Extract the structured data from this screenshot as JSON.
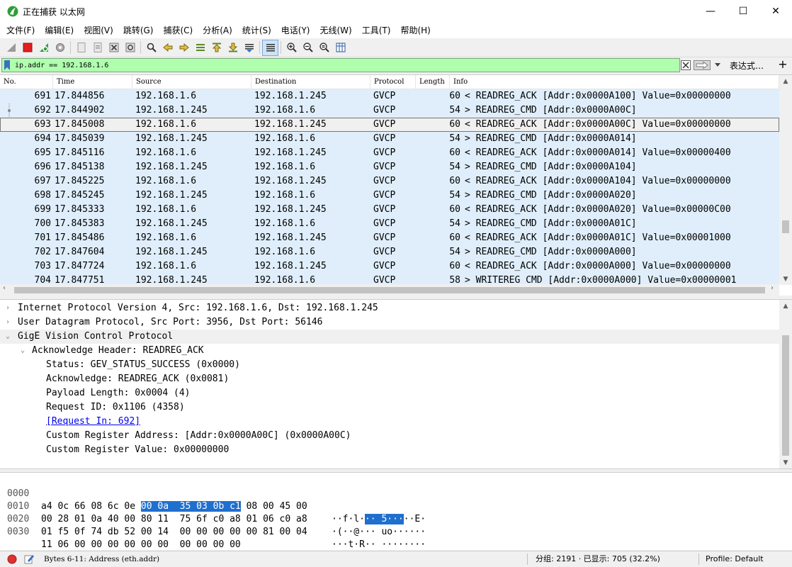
{
  "window": {
    "title": "正在捕获 以太网",
    "minimize": "—",
    "maximize": "☐",
    "close": "✕"
  },
  "menu": [
    "文件(F)",
    "编辑(E)",
    "视图(V)",
    "跳转(G)",
    "捕获(C)",
    "分析(A)",
    "统计(S)",
    "电话(Y)",
    "无线(W)",
    "工具(T)",
    "帮助(H)"
  ],
  "filter": {
    "value": "ip.addr == 192.168.1.6",
    "expression_label": "表达式…",
    "plus_label": "+"
  },
  "packet_list": {
    "columns": [
      "No.",
      "Time",
      "Source",
      "Destination",
      "Protocol",
      "Length",
      "Info"
    ],
    "rows": [
      {
        "no": "691",
        "time": "17.844856",
        "src": "192.168.1.6",
        "dst": "192.168.1.245",
        "proto": "GVCP",
        "len": "60",
        "info": "< READREG_ACK [Addr:0x0000A100] Value=0x00000000"
      },
      {
        "no": "692",
        "time": "17.844902",
        "src": "192.168.1.245",
        "dst": "192.168.1.6",
        "proto": "GVCP",
        "len": "54",
        "info": "> READREG_CMD [Addr:0x0000A00C]"
      },
      {
        "no": "693",
        "time": "17.845008",
        "src": "192.168.1.6",
        "dst": "192.168.1.245",
        "proto": "GVCP",
        "len": "60",
        "info": "< READREG_ACK [Addr:0x0000A00C] Value=0x00000000"
      },
      {
        "no": "694",
        "time": "17.845039",
        "src": "192.168.1.245",
        "dst": "192.168.1.6",
        "proto": "GVCP",
        "len": "54",
        "info": "> READREG_CMD [Addr:0x0000A014]"
      },
      {
        "no": "695",
        "time": "17.845116",
        "src": "192.168.1.6",
        "dst": "192.168.1.245",
        "proto": "GVCP",
        "len": "60",
        "info": "< READREG_ACK [Addr:0x0000A014] Value=0x00000400"
      },
      {
        "no": "696",
        "time": "17.845138",
        "src": "192.168.1.245",
        "dst": "192.168.1.6",
        "proto": "GVCP",
        "len": "54",
        "info": "> READREG_CMD [Addr:0x0000A104]"
      },
      {
        "no": "697",
        "time": "17.845225",
        "src": "192.168.1.6",
        "dst": "192.168.1.245",
        "proto": "GVCP",
        "len": "60",
        "info": "< READREG_ACK [Addr:0x0000A104] Value=0x00000000"
      },
      {
        "no": "698",
        "time": "17.845245",
        "src": "192.168.1.245",
        "dst": "192.168.1.6",
        "proto": "GVCP",
        "len": "54",
        "info": "> READREG_CMD [Addr:0x0000A020]"
      },
      {
        "no": "699",
        "time": "17.845333",
        "src": "192.168.1.6",
        "dst": "192.168.1.245",
        "proto": "GVCP",
        "len": "60",
        "info": "< READREG_ACK [Addr:0x0000A020] Value=0x00000C00"
      },
      {
        "no": "700",
        "time": "17.845383",
        "src": "192.168.1.245",
        "dst": "192.168.1.6",
        "proto": "GVCP",
        "len": "54",
        "info": "> READREG_CMD [Addr:0x0000A01C]"
      },
      {
        "no": "701",
        "time": "17.845486",
        "src": "192.168.1.6",
        "dst": "192.168.1.245",
        "proto": "GVCP",
        "len": "60",
        "info": "< READREG_ACK [Addr:0x0000A01C] Value=0x00001000"
      },
      {
        "no": "702",
        "time": "17.847604",
        "src": "192.168.1.245",
        "dst": "192.168.1.6",
        "proto": "GVCP",
        "len": "54",
        "info": "> READREG_CMD [Addr:0x0000A000]"
      },
      {
        "no": "703",
        "time": "17.847724",
        "src": "192.168.1.6",
        "dst": "192.168.1.245",
        "proto": "GVCP",
        "len": "60",
        "info": "< READREG_ACK [Addr:0x0000A000] Value=0x00000000"
      },
      {
        "no": "704",
        "time": "17.847751",
        "src": "192.168.1.245",
        "dst": "192.168.1.6",
        "proto": "GVCP",
        "len": "58",
        "info": "> WRITEREG_CMD [Addr:0x0000A000] Value=0x00000001"
      }
    ]
  },
  "details": {
    "lines": [
      "Internet Protocol Version 4, Src: 192.168.1.6, Dst: 192.168.1.245",
      "User Datagram Protocol, Src Port: 3956, Dst Port: 56146",
      "GigE Vision Control Protocol",
      "Acknowledge Header: READREG_ACK",
      "Status: GEV_STATUS_SUCCESS (0x0000)",
      "Acknowledge: READREG_ACK (0x0081)",
      "Payload Length: 0x0004 (4)",
      "Request ID: 0x1106 (4358)",
      "[Request In: 692]",
      "Custom Register Address: [Addr:0x0000A00C] (0x0000A00C)",
      "Custom Register Value: 0x00000000"
    ]
  },
  "bytes": {
    "rows": [
      {
        "offset": "0000",
        "hex_pre": "a4 0c 66 08 6c 0e ",
        "hex_sel": "00 0a  35 03 0b c1",
        "hex_post": " 08 00 45 00",
        "ascii_pre": "··f·l·",
        "ascii_sel": "·· 5···",
        "ascii_post": "··E·"
      },
      {
        "offset": "0010",
        "hex_pre": "00 28 01 0a 40 00 80 11  75 6f c0 a8 01 06 c0 a8",
        "hex_sel": "",
        "hex_post": "",
        "ascii_pre": "·(··@··· uo······",
        "ascii_sel": "",
        "ascii_post": ""
      },
      {
        "offset": "0020",
        "hex_pre": "01 f5 0f 74 db 52 00 14  00 00 00 00 00 81 00 04",
        "hex_sel": "",
        "hex_post": "",
        "ascii_pre": "···t·R·· ········",
        "ascii_sel": "",
        "ascii_post": ""
      },
      {
        "offset": "0030",
        "hex_pre": "11 06 00 00 00 00 00 00  00 00 00 00",
        "hex_sel": "",
        "hex_post": "",
        "ascii_pre": "········ ····",
        "ascii_sel": "",
        "ascii_post": ""
      }
    ]
  },
  "status": {
    "field": "Bytes 6-11: Address (eth.addr)",
    "packets": "分组: 2191 · 已显示: 705 (32.2%)",
    "profile": "Profile: Default"
  },
  "colors": {
    "row_bg": "#dfeefa",
    "filter_bg": "#afffaf",
    "selection": "#1f6fce"
  }
}
